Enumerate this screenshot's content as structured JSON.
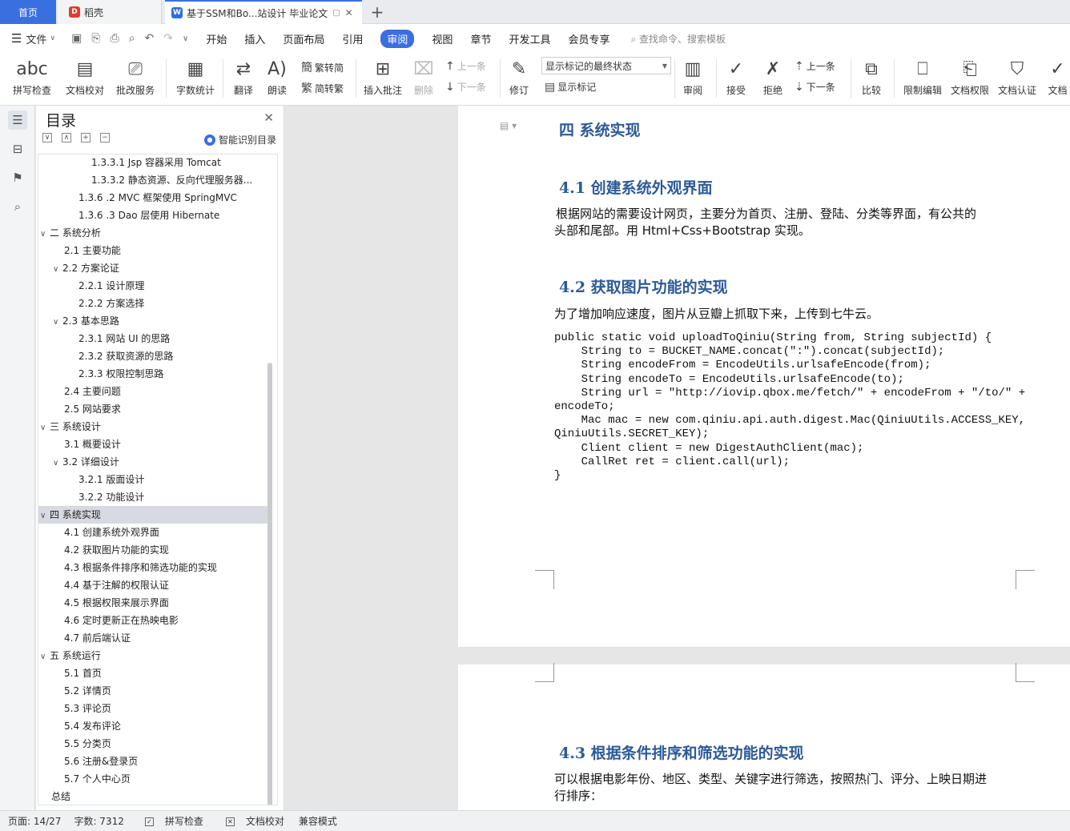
{
  "tabs": {
    "home": "首页",
    "daoke": "稻壳",
    "doc": "基于SSM和Bo...站设计 毕业论文",
    "add": "+"
  },
  "menu": {
    "file": "文件",
    "items": [
      "开始",
      "插入",
      "页面布局",
      "引用",
      "审阅",
      "视图",
      "章节",
      "开发工具",
      "会员专享"
    ],
    "active": "审阅",
    "search": "查找命令、搜索模板"
  },
  "ribbon": {
    "spell": "拼写检查",
    "proof": "文档校对",
    "batch": "批改服务",
    "wordcount": "字数统计",
    "translate": "翻译",
    "read": "朗读",
    "to_trad": "繁转简",
    "to_simp": "简转繁",
    "insert_comment": "插入批注",
    "delete": "删除",
    "prev": "上一条",
    "next": "下一条",
    "revise": "修订",
    "state_select": "显示标记的最终状态",
    "show_marks": "显示标记",
    "review": "审阅",
    "accept": "接受",
    "reject": "拒绝",
    "prev2": "上一条",
    "next2": "下一条",
    "compare": "比较",
    "restrict": "限制编辑",
    "perm": "文档权限",
    "auth": "文档认证",
    "more": "文档"
  },
  "toc": {
    "title": "目录",
    "smart": "智能识别目录",
    "items": [
      {
        "label": "1.3.3.1 Jsp 容器采用 Tomcat",
        "level": 4,
        "chev": ""
      },
      {
        "label": "1.3.3.2 静态资源、反向代理服务器...",
        "level": 4,
        "chev": ""
      },
      {
        "label": "1.3.6 .2 MVC 框架使用 SpringMVC",
        "level": 3,
        "chev": ""
      },
      {
        "label": "1.3.6 .3 Dao 层使用 Hibernate",
        "level": 3,
        "chev": ""
      },
      {
        "label": "二 系统分析",
        "level": 1,
        "chev": "∨"
      },
      {
        "label": "2.1 主要功能",
        "level": 2,
        "chev": ""
      },
      {
        "label": "2.2 方案论证",
        "level": 2,
        "chev": "∨"
      },
      {
        "label": "2.2.1 设计原理",
        "level": 3,
        "chev": ""
      },
      {
        "label": "2.2.2 方案选择",
        "level": 3,
        "chev": ""
      },
      {
        "label": "2.3 基本思路",
        "level": 2,
        "chev": "∨"
      },
      {
        "label": "2.3.1 网站 UI 的思路",
        "level": 3,
        "chev": ""
      },
      {
        "label": "2.3.2 获取资源的思路",
        "level": 3,
        "chev": ""
      },
      {
        "label": "2.3.3 权限控制思路",
        "level": 3,
        "chev": ""
      },
      {
        "label": "2.4 主要问题",
        "level": 2,
        "chev": ""
      },
      {
        "label": "2.5 网站要求",
        "level": 2,
        "chev": ""
      },
      {
        "label": "三 系统设计",
        "level": 1,
        "chev": "∨"
      },
      {
        "label": "3.1 概要设计",
        "level": 2,
        "chev": ""
      },
      {
        "label": "3.2 详细设计",
        "level": 2,
        "chev": "∨"
      },
      {
        "label": "3.2.1 版面设计",
        "level": 3,
        "chev": ""
      },
      {
        "label": "3.2.2 功能设计",
        "level": 3,
        "chev": ""
      },
      {
        "label": "四 系统实现",
        "level": 1,
        "chev": "∨",
        "selected": true
      },
      {
        "label": "4.1 创建系统外观界面",
        "level": 2,
        "chev": ""
      },
      {
        "label": "4.2 获取图片功能的实现",
        "level": 2,
        "chev": ""
      },
      {
        "label": "4.3 根据条件排序和筛选功能的实现",
        "level": 2,
        "chev": ""
      },
      {
        "label": "4.4 基于注解的权限认证",
        "level": 2,
        "chev": ""
      },
      {
        "label": "4.5 根据权限来展示界面",
        "level": 2,
        "chev": ""
      },
      {
        "label": "4.6 定时更新正在热映电影",
        "level": 2,
        "chev": ""
      },
      {
        "label": "4.7 前后端认证",
        "level": 2,
        "chev": ""
      },
      {
        "label": "五 系统运行",
        "level": 1,
        "chev": "∨"
      },
      {
        "label": "5.1 首页",
        "level": 2,
        "chev": ""
      },
      {
        "label": "5.2 详情页",
        "level": 2,
        "chev": ""
      },
      {
        "label": "5.3 评论页",
        "level": 2,
        "chev": ""
      },
      {
        "label": "5.4 发布评论",
        "level": 2,
        "chev": ""
      },
      {
        "label": "5.5 分类页",
        "level": 2,
        "chev": ""
      },
      {
        "label": "5.6 注册&登录页",
        "level": 2,
        "chev": ""
      },
      {
        "label": "5.7 个人中心页",
        "level": 2,
        "chev": ""
      },
      {
        "label": "总结",
        "level": 1,
        "chev": ""
      }
    ]
  },
  "doc": {
    "chapter": "四 系统实现",
    "h41": "4.1 创建系统外观界面",
    "p41a": "根据网站的需要设计网页，主要分为首页、注册、登陆、分类等界面，有公共的",
    "p41b": "头部和尾部。用 Html+Css+Bootstrap 实现。",
    "h42": "4.2 获取图片功能的实现",
    "p42": "为了增加响应速度，图片从豆瓣上抓取下来，上传到七牛云。",
    "code": "public static void uploadToQiniu(String from, String subjectId) {\n    String to = BUCKET_NAME.concat(\":\").concat(subjectId);\n    String encodeFrom = EncodeUtils.urlsafeEncode(from);\n    String encodeTo = EncodeUtils.urlsafeEncode(to);\n    String url = \"http://iovip.qbox.me/fetch/\" + encodeFrom + \"/to/\" +\nencodeTo;\n    Mac mac = new com.qiniu.api.auth.digest.Mac(QiniuUtils.ACCESS_KEY,\nQiniuUtils.SECRET_KEY);\n    Client client = new DigestAuthClient(mac);\n    CallRet ret = client.call(url);\n}",
    "h43": "4.3 根据条件排序和筛选功能的实现",
    "p43a": "可以根据电影年份、地区、类型、关键字进行筛选，按照热门、评分、上映日期进",
    "p43b": "行排序："
  },
  "status": {
    "page": "页面: 14/27",
    "words": "字数: 7312",
    "spell": "拼写检查",
    "proof": "文档校对",
    "compat": "兼容模式"
  },
  "colors": {
    "accent": "#3a6fe0",
    "heading": "#2d5a96"
  }
}
